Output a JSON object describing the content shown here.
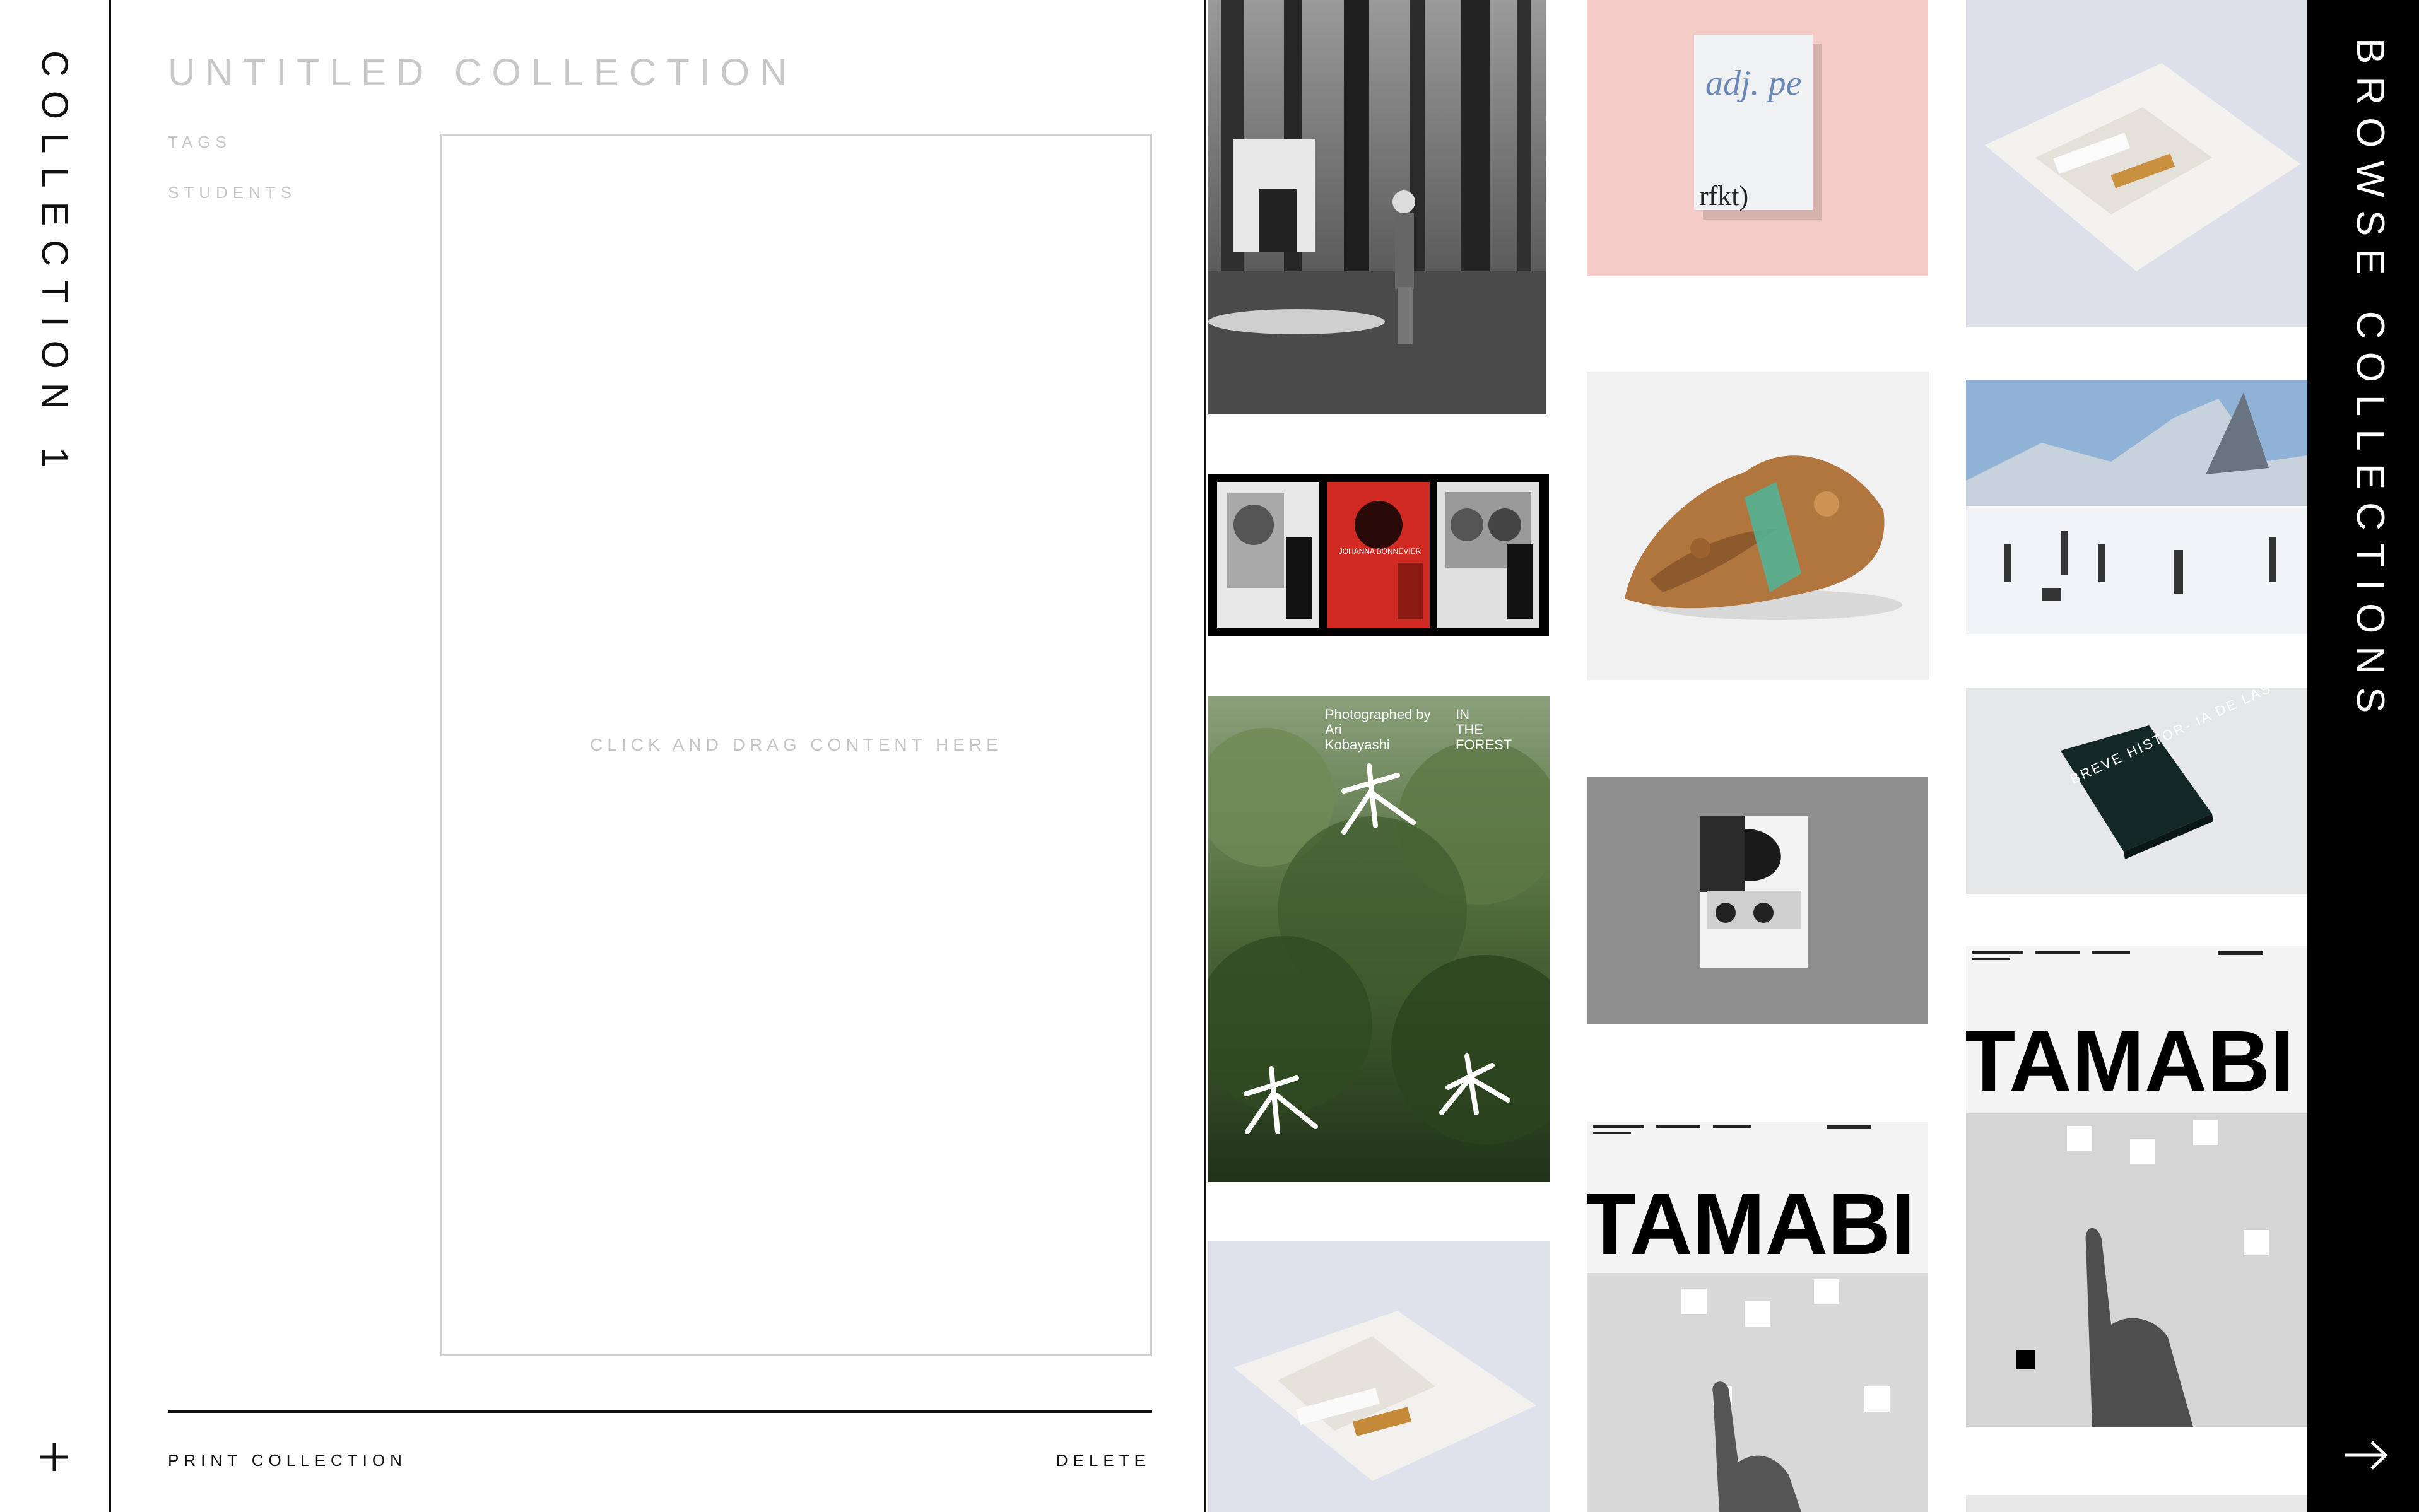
{
  "left_rail": {
    "collection_label": "COLLECTION 1",
    "add_icon": "plus-icon"
  },
  "editor": {
    "title": "UNTITLED COLLECTION",
    "tags_label": "TAGS",
    "students_label": "STUDENTS",
    "drop_hint": "CLICK AND DRAG CONTENT HERE",
    "print_label": "PRINT COLLECTION",
    "delete_label": "DELETE"
  },
  "grid": {
    "tiles": [
      {
        "name": "forest-flood-photo"
      },
      {
        "name": "poster-trio",
        "poster_text": "JOHANNA BONNEVIER"
      },
      {
        "name": "in-the-forest-cover",
        "line1": "Photographed by",
        "line2": "Ari",
        "line3": "Kobayashi",
        "title1": "IN",
        "title2": "THE",
        "title3": "FOREST"
      },
      {
        "name": "envelope-photo"
      },
      {
        "name": "adj-book-photo",
        "cover_text": "adj. pe",
        "cover_sub": "rfkt)"
      },
      {
        "name": "rock-glass-photo"
      },
      {
        "name": "booklet-concrete-photo"
      },
      {
        "name": "tamabi-poster-a",
        "text": "TAMABI"
      },
      {
        "name": "folded-envelope-photo"
      },
      {
        "name": "matterhorn-photo"
      },
      {
        "name": "breve-historia-book",
        "cover_text": "BREVE HISTOR- IA DE LAS COSAS"
      },
      {
        "name": "tamabi-poster-b",
        "text": "TAMABI"
      }
    ]
  },
  "right_rail": {
    "browse_label": "BROWSE COLLECTIONS",
    "arrow_icon": "arrow-right-icon"
  }
}
